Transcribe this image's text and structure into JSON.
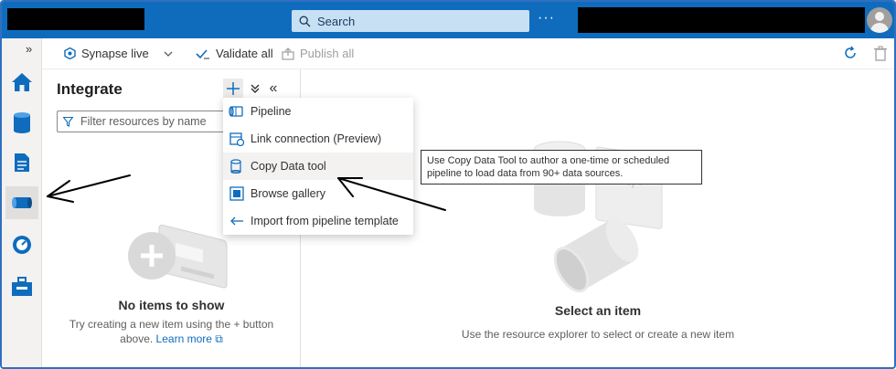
{
  "topbar": {
    "search_placeholder": "Search",
    "more_label": "···"
  },
  "toolbar": {
    "workspace_label": "Synapse live",
    "validate_label": "Validate all",
    "publish_label": "Publish all"
  },
  "rail": {
    "expand_label": "»",
    "items": [
      "home",
      "data",
      "develop",
      "integrate",
      "monitor",
      "manage"
    ]
  },
  "panel": {
    "title": "Integrate",
    "add_label": "+",
    "expand_all_label": "»",
    "collapse_label": "«",
    "filter_placeholder": "Filter resources by name",
    "empty_title": "No items to show",
    "empty_text": "Try creating a new item using the + button above.",
    "learn_more": "Learn more"
  },
  "menu": {
    "items": [
      {
        "label": "Pipeline",
        "icon": "pipeline-icon"
      },
      {
        "label": "Link connection (Preview)",
        "icon": "link-connection-icon"
      },
      {
        "label": "Copy Data tool",
        "icon": "copy-data-icon"
      },
      {
        "label": "Browse gallery",
        "icon": "gallery-icon"
      },
      {
        "label": "Import from pipeline template",
        "icon": "import-icon"
      }
    ]
  },
  "tooltip": {
    "text": "Use Copy Data Tool to author a one-time or scheduled pipeline to load data from 90+ data sources."
  },
  "main": {
    "title": "Select an item",
    "text": "Use the resource explorer to select or create a new item"
  },
  "colors": {
    "accent": "#0f6cbd",
    "frame": "#2f6fbf"
  }
}
